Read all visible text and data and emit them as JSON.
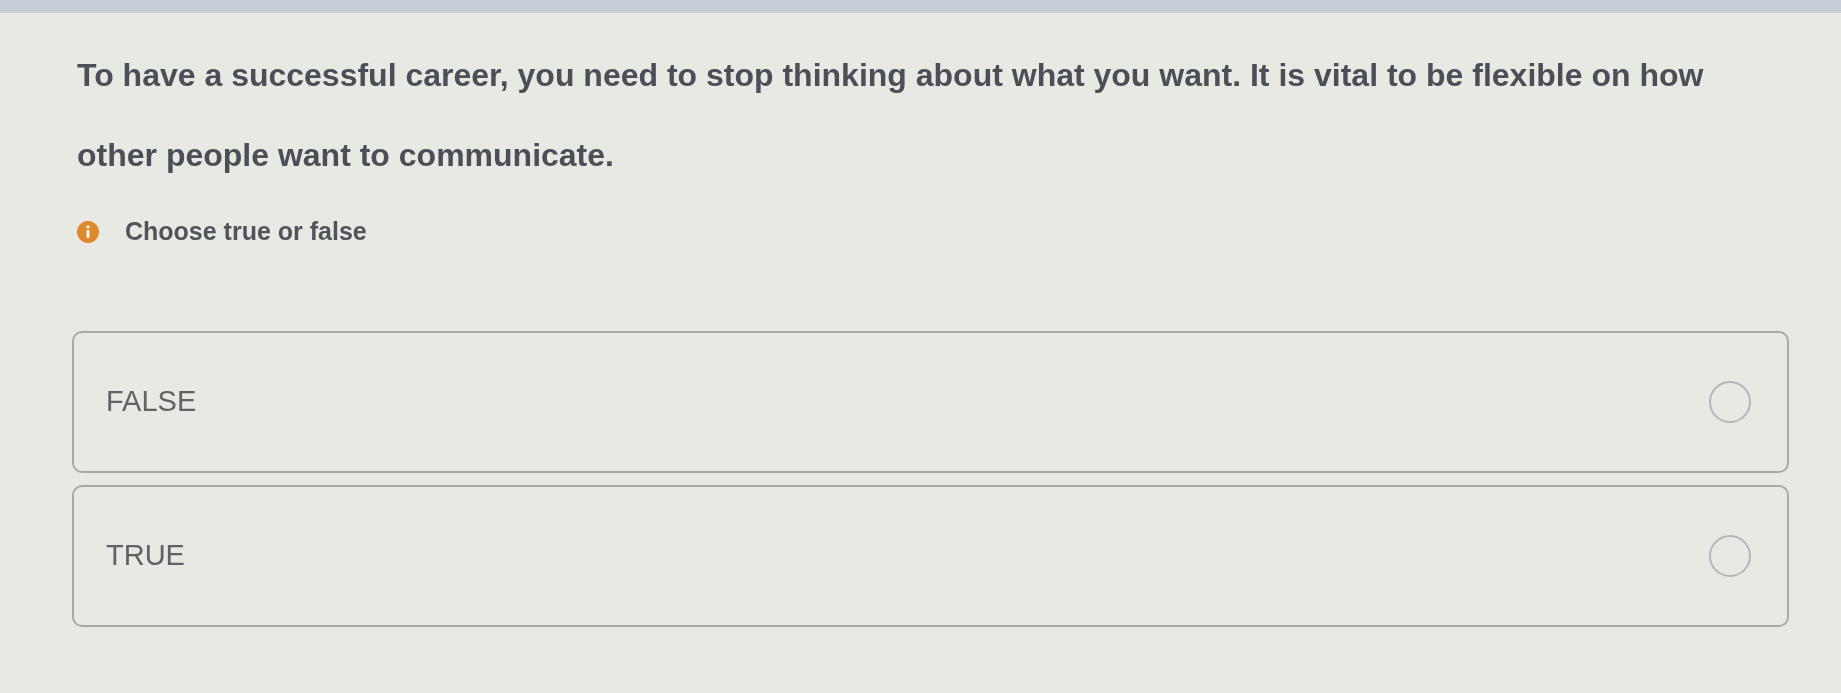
{
  "question": {
    "text": "To have a successful career, you need to stop thinking about what you want. It is vital to be flexible on how other people want to communicate."
  },
  "instruction": {
    "text": "Choose true or false"
  },
  "options": [
    {
      "label": "FALSE",
      "selected": false
    },
    {
      "label": "TRUE",
      "selected": false
    }
  ]
}
